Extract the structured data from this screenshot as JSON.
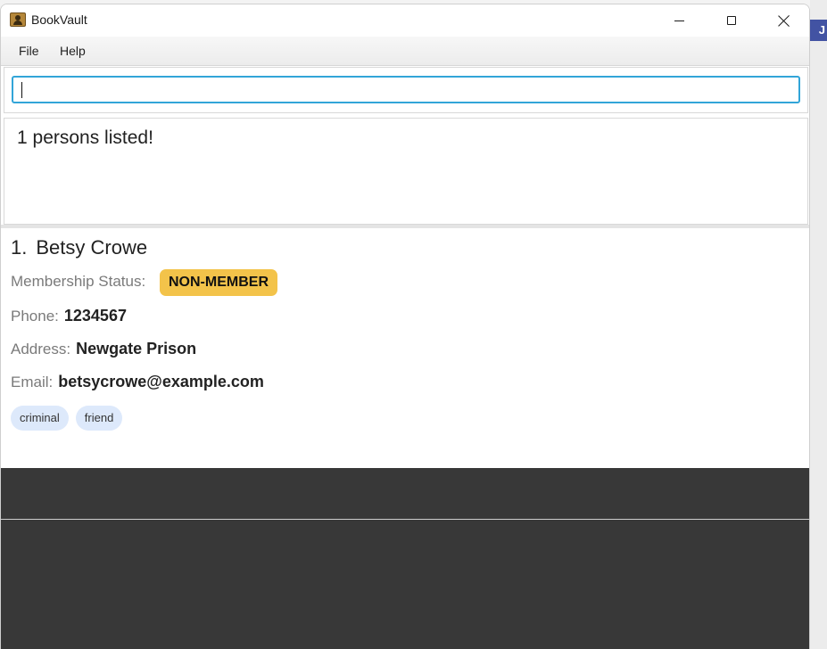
{
  "window": {
    "title": "BookVault"
  },
  "menu": {
    "items": [
      "File",
      "Help"
    ]
  },
  "command_box": {
    "value": "",
    "placeholder": ""
  },
  "result": {
    "message": "1 persons listed!"
  },
  "persons": [
    {
      "index": "1.",
      "name": "Betsy Crowe",
      "membership_label": "Membership Status:",
      "membership_status": "NON-MEMBER",
      "phone_label": "Phone:",
      "phone": "1234567",
      "address_label": "Address:",
      "address": "Newgate Prison",
      "email_label": "Email:",
      "email": "betsycrowe@example.com",
      "tags": [
        "criminal",
        "friend"
      ]
    }
  ],
  "colors": {
    "accent": "#32a5d8",
    "status_badge": "#f3c34a",
    "tag_bg": "#dde9fb",
    "dark_panel": "#383838"
  },
  "icons": {
    "app": "book-vault-icon",
    "minimize": "minimize-icon",
    "maximize": "maximize-icon",
    "close": "close-icon"
  }
}
